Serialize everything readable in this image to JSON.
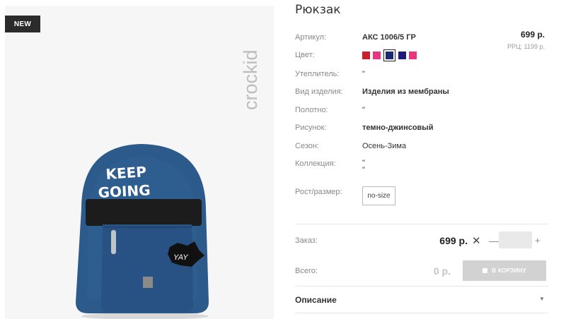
{
  "image": {
    "badge": "NEW",
    "brand": "crockid",
    "print_lines": [
      "KEEP",
      "GOING"
    ],
    "patch_text": "YAY"
  },
  "product": {
    "title": "Рюкзак",
    "price": "699 р.",
    "rrp": "РРЦ: 1199 р."
  },
  "attributes": [
    {
      "label": "Артикул:",
      "value": "АКС 1006/5 ГР"
    },
    {
      "label": "Цвет:",
      "value": ""
    },
    {
      "label": "Утеплитель:",
      "value": "\""
    },
    {
      "label": "Вид изделия:",
      "value": "Изделия из мембраны"
    },
    {
      "label": "Полотно:",
      "value": "\""
    },
    {
      "label": "Рисунок:",
      "value": "темно-джинсовый"
    },
    {
      "label": "Сезон:",
      "value": "Осень-Зима"
    },
    {
      "label": "Коллекция:",
      "value": "\"\n\""
    },
    {
      "label": "Рост/размер:",
      "value": "no-size"
    }
  ],
  "colors": [
    "#c8202c",
    "#e8357f",
    "#1b2a6e",
    "#1b1b7a",
    "#e8357f"
  ],
  "order": {
    "label": "Заказ:",
    "price": "699 р.",
    "times": "✕",
    "minus": "—",
    "plus": "+",
    "quantity": ""
  },
  "total": {
    "label": "Всего:",
    "value": "0 р.",
    "button": "В КОРЗИНУ"
  },
  "description": {
    "label": "Описание",
    "arrow": "▼"
  }
}
